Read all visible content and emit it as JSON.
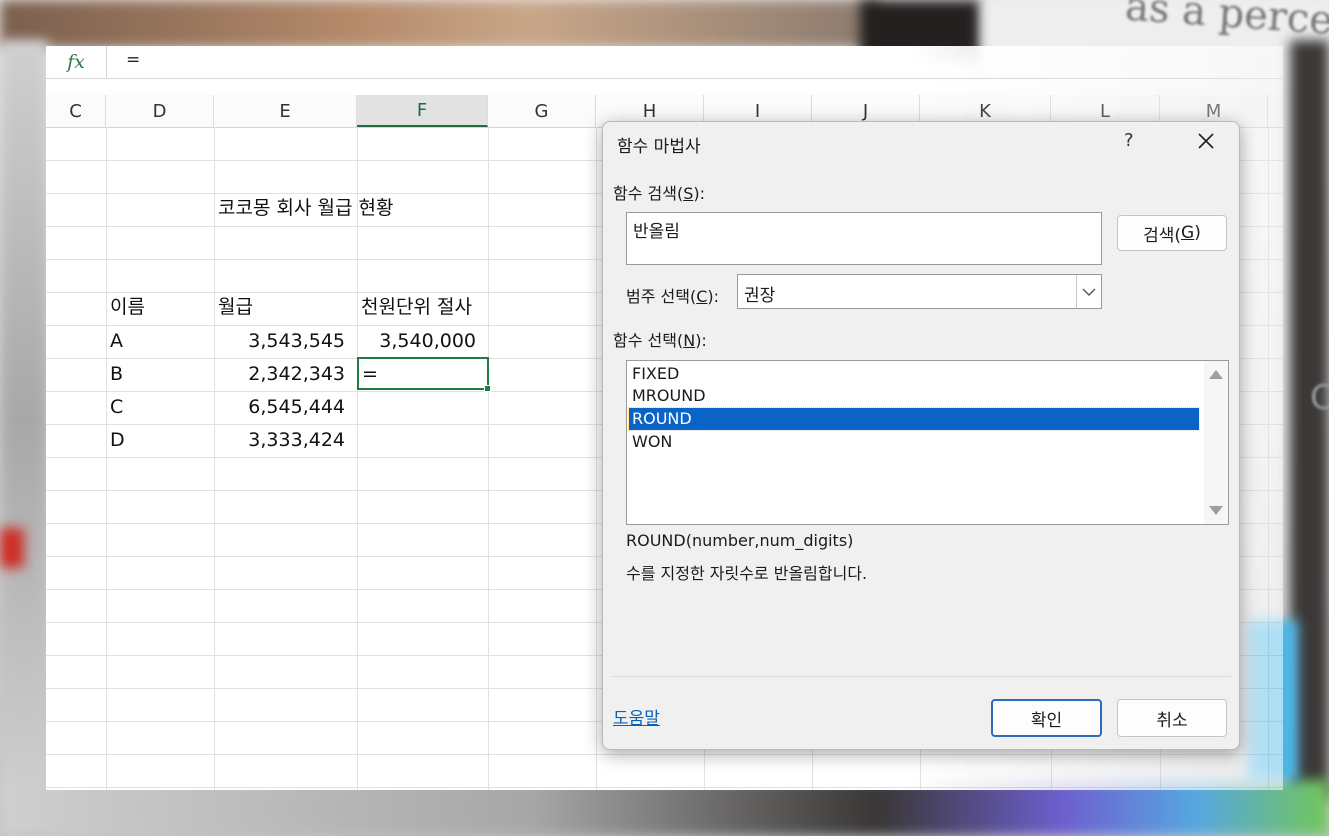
{
  "formula_bar": {
    "fx": "fx",
    "formula": "="
  },
  "columns": [
    {
      "letter": "C",
      "active": false
    },
    {
      "letter": "D",
      "active": false
    },
    {
      "letter": "E",
      "active": false
    },
    {
      "letter": "F",
      "active": true
    },
    {
      "letter": "G",
      "active": false
    },
    {
      "letter": "H",
      "active": false
    },
    {
      "letter": "I",
      "active": false
    },
    {
      "letter": "J",
      "active": false
    },
    {
      "letter": "K",
      "active": false
    },
    {
      "letter": "L",
      "active": false
    },
    {
      "letter": "M",
      "active": false
    }
  ],
  "sheet": {
    "title": "코코몽 회사 월급 현황",
    "headers": {
      "name": "이름",
      "salary": "월급",
      "rounded": "천원단위 절사"
    },
    "rows": [
      {
        "name": "A",
        "salary": "3,543,545",
        "rounded": "3,540,000"
      },
      {
        "name": "B",
        "salary": "2,342,343",
        "rounded": "="
      },
      {
        "name": "C",
        "salary": "6,545,444",
        "rounded": ""
      },
      {
        "name": "D",
        "salary": "3,333,424",
        "rounded": ""
      }
    ]
  },
  "dialog": {
    "title": "함수 마법사",
    "help_symbol": "?",
    "search_label": "함수 검색(",
    "search_key": "S",
    "search_value": "반올림",
    "search_button": "검색(",
    "search_button_key": "G",
    "category_label": "범주 선택(",
    "category_key": "C",
    "category_value": "권장",
    "function_label": "함수 선택(",
    "function_key": "N",
    "functions": [
      "FIXED",
      "MROUND",
      "ROUND",
      "WON"
    ],
    "selected_function": "ROUND",
    "signature": "ROUND(number,num_digits)",
    "description": "수를 지정한 자릿수로 반올림합니다.",
    "help_link": "도움말",
    "ok_button": "확인",
    "cancel_button": "취소"
  },
  "background": {
    "text": "as a percentag",
    "letter": "C"
  },
  "colors": {
    "excel_green": "#1f7a45",
    "selection_blue": "#0a64c8",
    "link_blue": "#0a5fb7"
  }
}
